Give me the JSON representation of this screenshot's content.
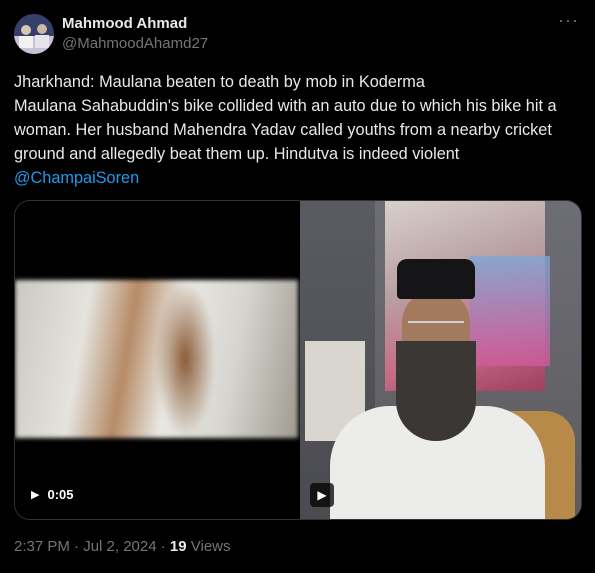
{
  "author": {
    "name": "Mahmood Ahmad",
    "handle": "@MahmoodAhamd27",
    "avatar_icon": "avatar-image"
  },
  "more_icon": "more-options-icon",
  "tweet": {
    "line1": "Jharkhand: Maulana beaten to death by mob in Koderma",
    "line2": "Maulana Sahabuddin's bike collided with an auto due to which his bike hit a woman. Her husband Mahendra Yadav called youths from a nearby cricket ground and allegedly beat them up. Hindutva is indeed violent",
    "mention": "@ChampaiSoren"
  },
  "media": {
    "video1_duration": "0:05"
  },
  "meta": {
    "time_date": "2:37 PM · Jul 2, 2024 · ",
    "views_count": "19",
    "views_label": " Views"
  },
  "colors": {
    "background": "#000000",
    "text": "#e7e9ea",
    "secondary": "#71767b",
    "link": "#1d9bf0"
  }
}
